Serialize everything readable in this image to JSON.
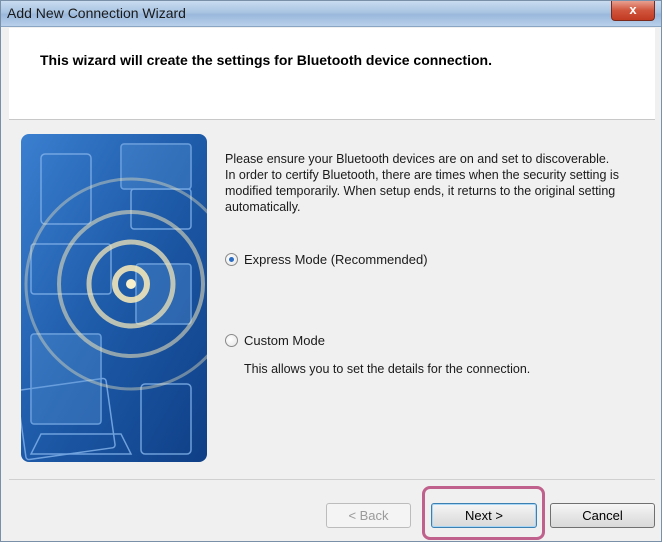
{
  "window": {
    "title": "Add New Connection Wizard",
    "close_label": "x"
  },
  "header": {
    "text": "This wizard will create the settings for Bluetooth device connection."
  },
  "content": {
    "paragraph1": "Please ensure your Bluetooth devices are on and set to discoverable.",
    "paragraph2": "In order to certify Bluetooth, there are times when the security setting is modified temporarily. When setup ends, it returns to the original setting automatically."
  },
  "options": {
    "express": {
      "label": "Express Mode (Recommended)",
      "selected": true
    },
    "custom": {
      "label": "Custom Mode",
      "selected": false,
      "description": "This allows you to set the details for the connection."
    }
  },
  "buttons": {
    "back": "< Back",
    "next": "Next >",
    "cancel": "Cancel"
  },
  "colors": {
    "illustration_bg": "#1f5fae",
    "highlight": "#c0608c"
  }
}
